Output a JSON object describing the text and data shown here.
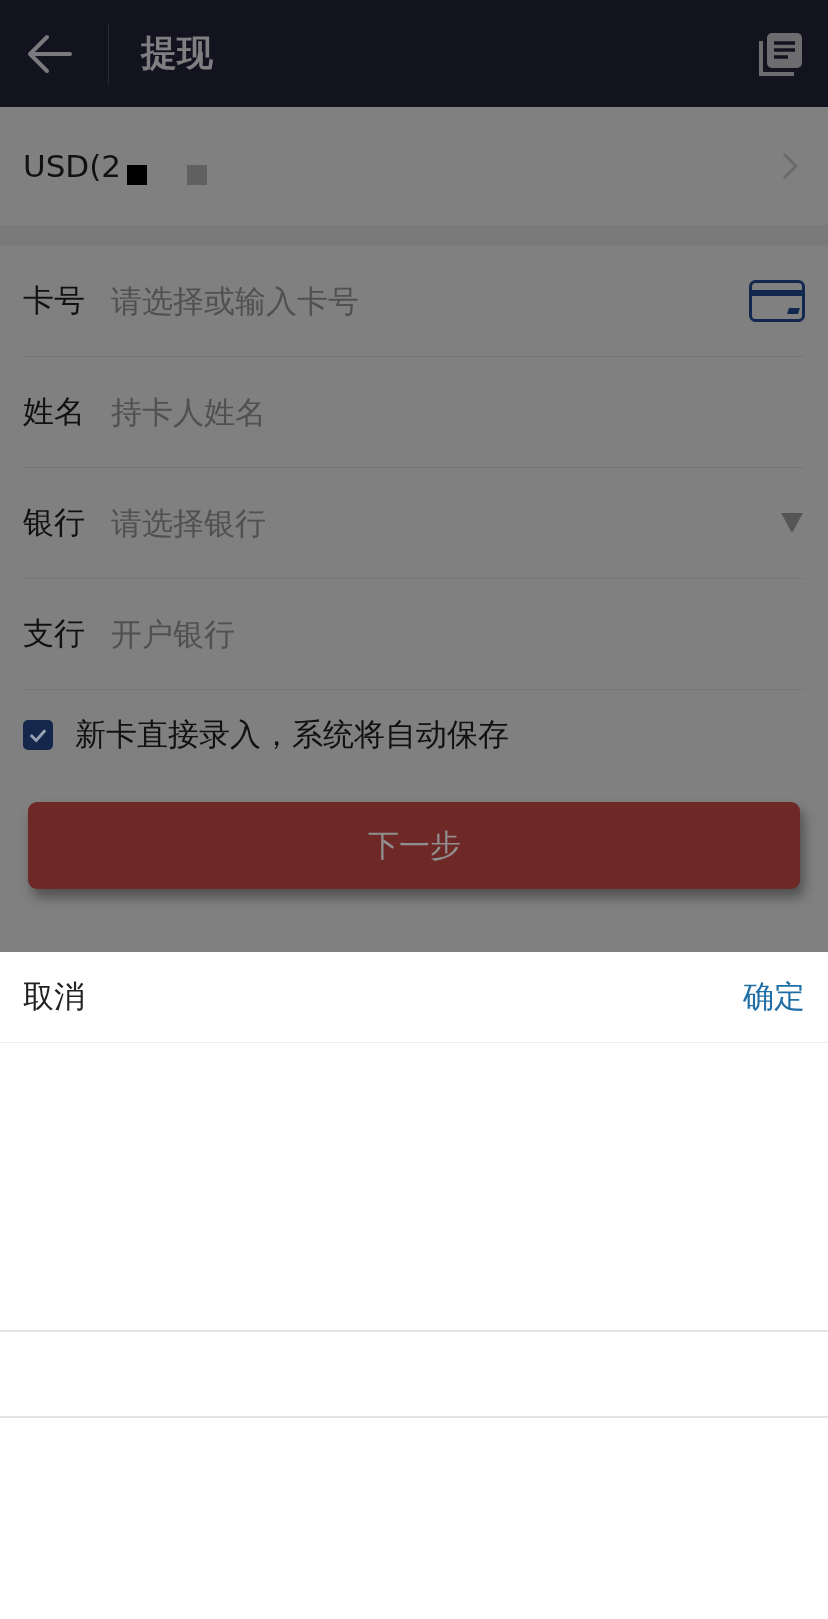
{
  "header": {
    "title": "提现"
  },
  "account": {
    "text": "USD(2"
  },
  "fields": [
    {
      "label": "卡号",
      "placeholder": "请选择或输入卡号",
      "kind": "card"
    },
    {
      "label": "姓名",
      "placeholder": "持卡人姓名",
      "kind": "text"
    },
    {
      "label": "银行",
      "placeholder": "请选择银行",
      "kind": "select"
    },
    {
      "label": "支行",
      "placeholder": "开户银行",
      "kind": "text"
    }
  ],
  "save_option": {
    "label": "新卡直接录入，系统将自动保存",
    "checked": true
  },
  "next_button": {
    "label": "下一步"
  },
  "picker": {
    "cancel": "取消",
    "confirm": "确定"
  }
}
